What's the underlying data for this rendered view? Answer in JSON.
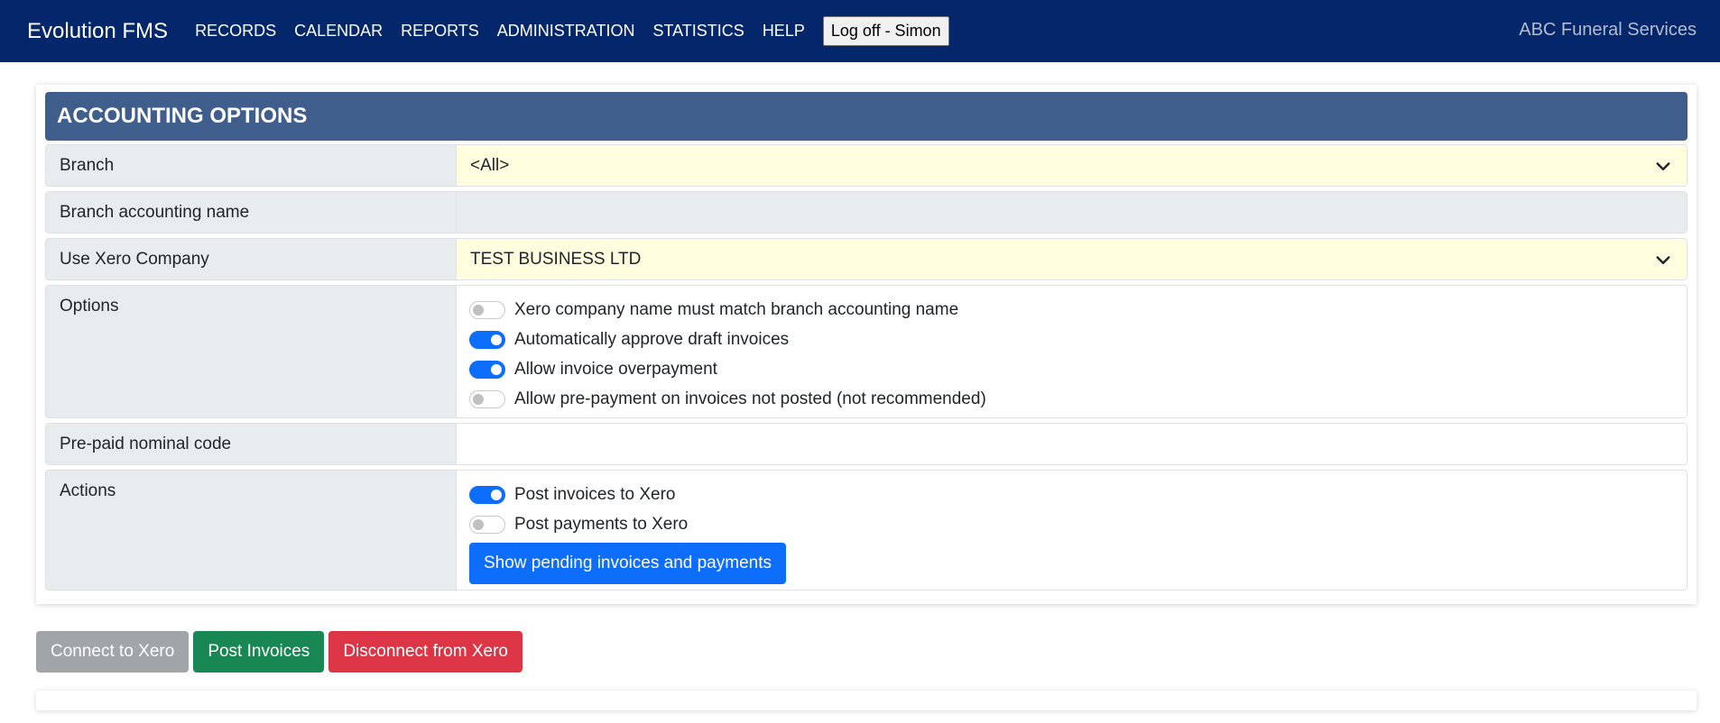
{
  "navbar": {
    "brand": "Evolution FMS",
    "items": [
      "RECORDS",
      "CALENDAR",
      "REPORTS",
      "ADMINISTRATION",
      "STATISTICS",
      "HELP"
    ],
    "logoff_label": "Log off - Simon",
    "company_name": "ABC Funeral Services",
    "background_color": "#04266a"
  },
  "accounting": {
    "title": "ACCOUNTING OPTIONS",
    "header_color": "#3f5e8b",
    "branch": {
      "label": "Branch",
      "value": "<All>",
      "icon": "chevron-down-icon"
    },
    "branch_accounting_name": {
      "label": "Branch accounting name",
      "value": ""
    },
    "xero_company": {
      "label": "Use Xero Company",
      "value": "TEST BUSINESS LTD",
      "icon": "chevron-down-icon"
    },
    "options": {
      "label": "Options",
      "items": [
        {
          "label": "Xero company name must match branch accounting name",
          "checked": false
        },
        {
          "label": "Automatically approve draft invoices",
          "checked": true
        },
        {
          "label": "Allow invoice overpayment",
          "checked": true
        },
        {
          "label": "Allow pre-payment on invoices not posted (not recommended)",
          "checked": false
        }
      ]
    },
    "prepaid_nominal_code": {
      "label": "Pre-paid nominal code",
      "value": ""
    },
    "actions": {
      "label": "Actions",
      "items": [
        {
          "label": "Post invoices to Xero",
          "checked": true
        },
        {
          "label": "Post payments to Xero",
          "checked": false
        }
      ],
      "button_label": "Show pending invoices and payments"
    }
  },
  "footer_buttons": {
    "connect": "Connect to Xero",
    "post_invoices": "Post Invoices",
    "disconnect": "Disconnect from Xero"
  },
  "colors": {
    "primary": "#0d6efd",
    "success": "#198754",
    "danger": "#dc3545",
    "secondary": "#a2a5a8",
    "select_highlight": "#ffffe0"
  }
}
